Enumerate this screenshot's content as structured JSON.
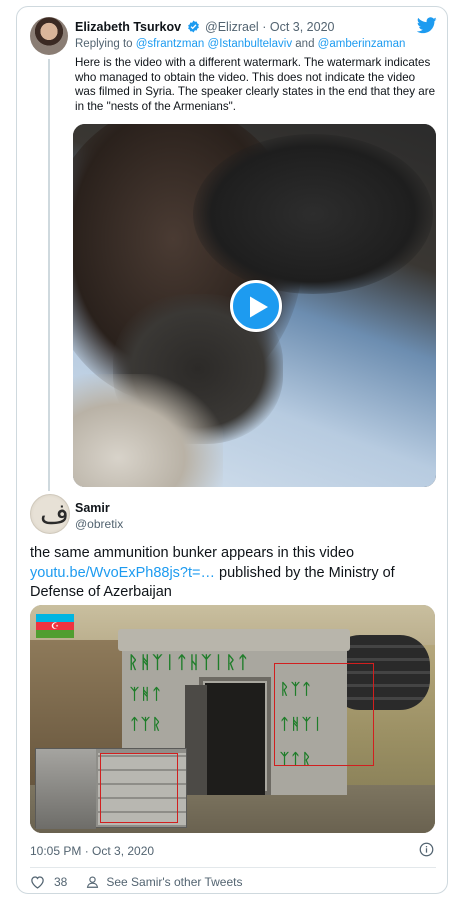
{
  "reply_tweet": {
    "author_name": "Elizabeth Tsurkov",
    "author_handle": "@Elizrael",
    "separator": "·",
    "date": "Oct 3, 2020",
    "replying_prefix": "Replying to",
    "replying_to": [
      "@sfrantzman",
      "@Istanbultelaviv",
      "@amberinzaman"
    ],
    "replying_and": "and",
    "text": "Here is the video with a different watermark. The watermark indicates who managed to obtain the video. This does not indicate the video was filmed in Syria. The speaker clearly states in the end that they are in the \"nests of the Armenians\".",
    "media_icon": "play-icon"
  },
  "main_tweet": {
    "author_name": "Samir",
    "author_handle": "@obretix",
    "avatar_glyph": "ف",
    "text_before_link": "the same ammunition bunker appears in this video ",
    "link_text": "youtu.be/WvoExPh88js?t=…",
    "text_after_link": " published by the Ministry of Defense of Azerbaijan",
    "timestamp": "10:05 PM · Oct 3, 2020",
    "like_count": "38",
    "see_more_label": "See Samir's other Tweets"
  },
  "icons": {
    "brand": "twitter-bird-icon",
    "verified": "verified-badge-icon",
    "info": "info-icon",
    "like": "heart-icon",
    "profile": "person-icon"
  },
  "colors": {
    "accent": "#1d9bf0",
    "text_primary": "#0f1419",
    "text_secondary": "#536471",
    "border": "#cfd9de"
  }
}
